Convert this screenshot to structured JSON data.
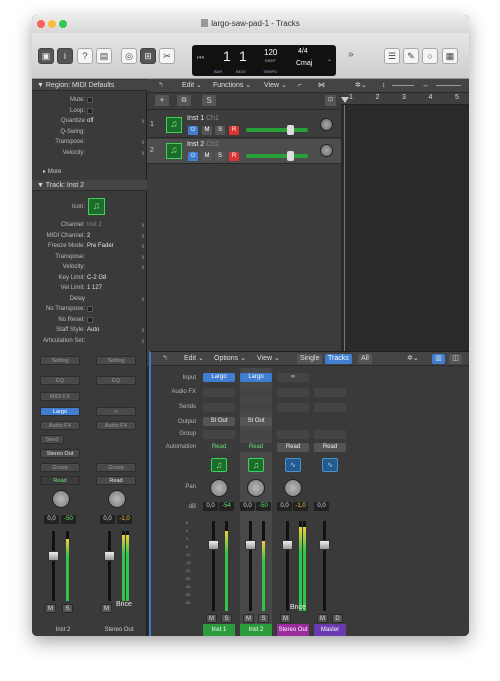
{
  "window": {
    "title": "largo-saw-pad-1 - Tracks"
  },
  "lcd": {
    "bar": "1",
    "beat": "1",
    "bar_label": "BAR",
    "beat_label": "BEAT",
    "tempo": "120",
    "tempo_mode": "KEEP",
    "tempo_label": "TEMPO",
    "sig_top": "4/4",
    "key": "Cmaj"
  },
  "inspector": {
    "region_header": "Region: MIDI Defaults",
    "region_rows": [
      {
        "label": "Mute:",
        "value": "",
        "checkbox": true
      },
      {
        "label": "Loop:",
        "value": "",
        "checkbox": true
      },
      {
        "label": "Quantize",
        "value": "off",
        "menu": true
      },
      {
        "label": "Q-Swing:",
        "value": ""
      },
      {
        "label": "Transpose:",
        "value": "",
        "menu": true
      },
      {
        "label": "Velocity:",
        "value": "",
        "menu": true
      }
    ],
    "more_label": "More",
    "track_header": "Track:  Inst 2",
    "icon_label": "Icon:",
    "track_rows": [
      {
        "label": "Channel:",
        "value": "Inst 2",
        "menu": true,
        "dim": true
      },
      {
        "label": "MIDI Channel:",
        "value": "2",
        "menu": true
      },
      {
        "label": "Freeze Mode:",
        "value": "Pre Fader",
        "menu": true
      },
      {
        "label": "Transpose:",
        "value": "",
        "menu": true
      },
      {
        "label": "Velocity:",
        "value": "",
        "menu": true
      },
      {
        "label": "Key Limit:",
        "value": "C-2  G8"
      },
      {
        "label": "Vel Limit:",
        "value": "1  127"
      },
      {
        "label": "Delay",
        "value": "",
        "menu": true
      },
      {
        "label": "No Transpose:",
        "value": "",
        "checkbox": true
      },
      {
        "label": "No Reset:",
        "value": "",
        "checkbox": true
      },
      {
        "label": "Staff Style:",
        "value": "Auto",
        "menu": true
      },
      {
        "label": "Articulation Set:",
        "value": "",
        "menu": true
      }
    ],
    "strips": [
      {
        "setting": "Setting",
        "eq": "EQ",
        "midi_fx": "MIDI FX",
        "input": "Largo",
        "audio_fx": "Audio FX",
        "send": "Send",
        "output": "Stereo Out",
        "group": "Group",
        "automation": "Read",
        "vol": "0,0",
        "peak": "-50",
        "m": "M",
        "s": "S",
        "name": "Inst 2"
      },
      {
        "setting": "Setting",
        "eq": "EQ",
        "audio_fx": "Audio FX",
        "group": "Group",
        "automation": "Read",
        "vol": "0,0",
        "peak": "-1,0",
        "m": "M",
        "bnce": "Bnce",
        "name": "Stereo Out"
      }
    ]
  },
  "tracks_menu": {
    "edit": "Edit",
    "functions": "Functions",
    "view": "View"
  },
  "tracks": [
    {
      "num": "1",
      "name": "Inst 1",
      "ch": "Ch1",
      "m": "M",
      "s": "S",
      "r": "R",
      "volume": 0.72
    },
    {
      "num": "2",
      "name": "Inst 2",
      "ch": "Ch2",
      "m": "M",
      "s": "S",
      "r": "R",
      "volume": 0.72
    }
  ],
  "ruler": [
    "1",
    "2",
    "3",
    "4",
    "5"
  ],
  "mixer": {
    "menu": {
      "edit": "Edit",
      "options": "Options",
      "view": "View",
      "single": "Single",
      "tracks": "Tracks",
      "all": "All"
    },
    "row_labels": {
      "input": "Input",
      "audio_fx": "Audio FX",
      "sends": "Sends",
      "output": "Output",
      "group": "Group",
      "automation": "Automation",
      "pan": "Pan",
      "db": "dB"
    },
    "channels": [
      {
        "input": "Largo",
        "output": "St Out",
        "automation": "Read",
        "vol": "0,0",
        "peak": "-54",
        "m": "M",
        "s": "S",
        "name": "Inst 1",
        "color": "#2c9b3c"
      },
      {
        "input": "Largo",
        "output": "St Out",
        "automation": "Read",
        "vol": "0,0",
        "peak": "-50",
        "m": "M",
        "s": "S",
        "name": "Inst 2",
        "color": "#2c9b3c"
      },
      {
        "input": "",
        "output": "",
        "automation": "Read",
        "vol": "0,0",
        "peak": "-1,0",
        "m": "M",
        "bnce": "Bnce",
        "name": "Stereo Out",
        "color": "#9a2c9c"
      },
      {
        "input": "",
        "output": "",
        "automation": "Read",
        "vol": "0,0",
        "peak": "",
        "m": "M",
        "d": "D",
        "name": "Master",
        "color": "#6a3ab0"
      }
    ]
  }
}
